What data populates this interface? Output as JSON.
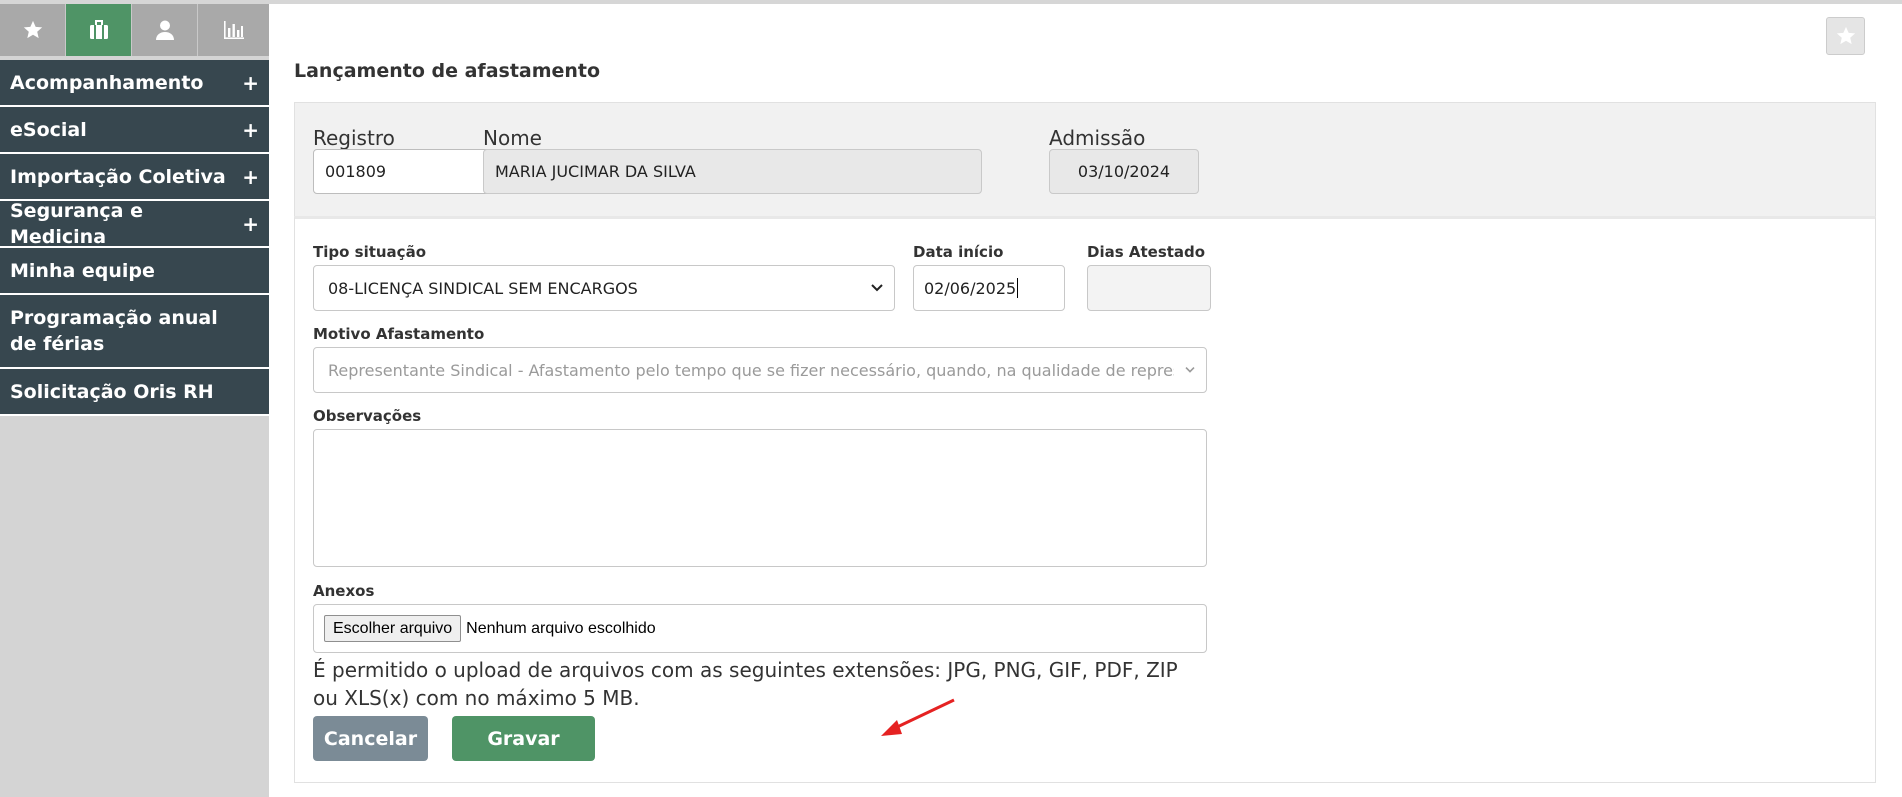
{
  "sidebar": {
    "tabs": [
      {
        "icon": "star-icon",
        "active": false
      },
      {
        "icon": "briefcase-icon",
        "active": true
      },
      {
        "icon": "user-icon",
        "active": false
      },
      {
        "icon": "bar-chart-icon",
        "active": false
      }
    ],
    "menu": [
      {
        "label": "Acompanhamento",
        "plus": "+"
      },
      {
        "label": "eSocial",
        "plus": "+"
      },
      {
        "label": "Importação Coletiva",
        "plus": "+"
      },
      {
        "label": "Segurança e Medicina",
        "plus": "+"
      },
      {
        "label": "Minha equipe"
      },
      {
        "label": "Programação anual de férias"
      },
      {
        "label": "Solicitação Oris RH"
      }
    ]
  },
  "page": {
    "title": "Lançamento de afastamento"
  },
  "header": {
    "registro_label": "Registro",
    "registro_value": "001809",
    "nome_label": "Nome",
    "nome_value": "MARIA JUCIMAR DA SILVA",
    "admissao_label": "Admissão",
    "admissao_value": "03/10/2024"
  },
  "form": {
    "tipo_situacao_label": "Tipo situação",
    "tipo_situacao_value": "08-LICENÇA SINDICAL SEM ENCARGOS",
    "data_inicio_label": "Data início",
    "data_inicio_value": "02/06/2025",
    "dias_atestado_label": "Dias Atestado",
    "dias_atestado_value": "",
    "motivo_label": "Motivo Afastamento",
    "motivo_value": "Representante Sindical - Afastamento pelo tempo que se fizer necessário, quando, na qualidade de representc",
    "observacoes_label": "Observações",
    "observacoes_value": "",
    "anexos_label": "Anexos",
    "file_button_label": "Escolher arquivo",
    "file_status": "Nenhum arquivo escolhido",
    "help_text": "É permitido o upload de arquivos com as seguintes extensões: JPG, PNG, GIF, PDF, ZIP ou XLS(x) com no máximo 5 MB.",
    "cancel_label": "Cancelar",
    "save_label": "Gravar"
  },
  "colors": {
    "accent_green": "#4f9466",
    "sidebar_dark": "#37474f",
    "button_gray": "#7b8b96",
    "annotation_red": "#e52222"
  }
}
